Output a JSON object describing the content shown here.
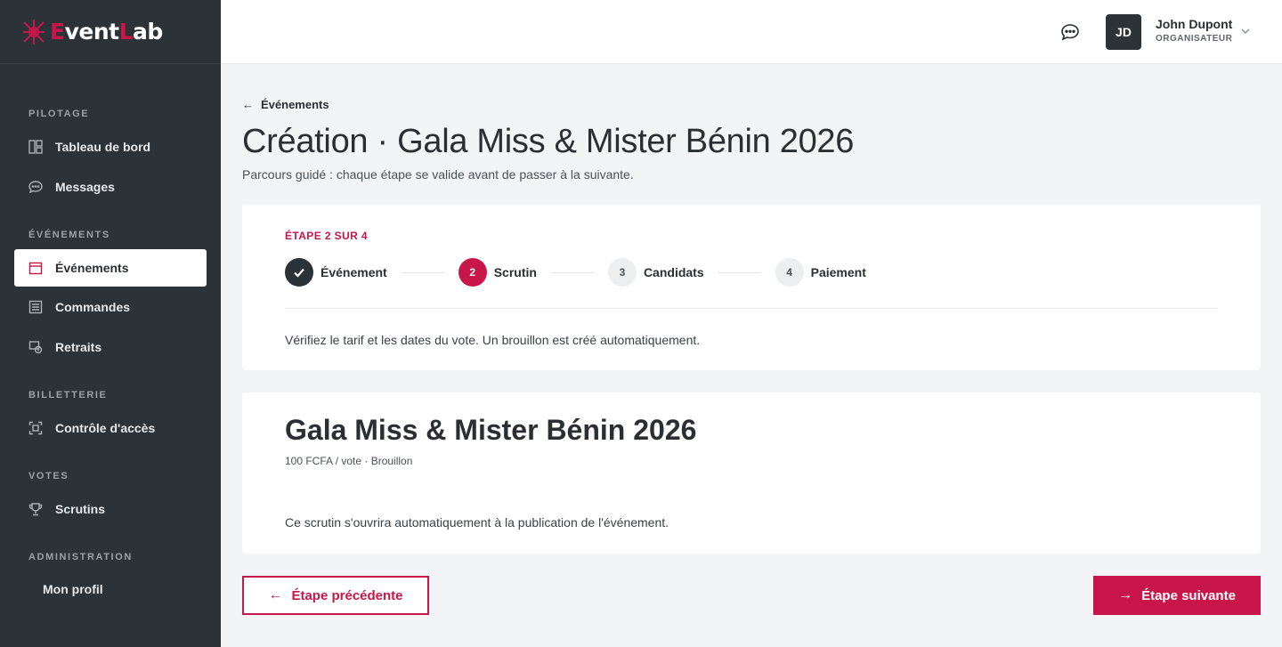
{
  "brand": {
    "part1": "E",
    "part2": "vent",
    "part3": "L",
    "part4": "ab",
    "accent_color": "#c8164a"
  },
  "sidebar": {
    "sections": [
      {
        "label": "PILOTAGE"
      },
      {
        "label": "ÉVÉNEMENTS"
      },
      {
        "label": "BILLETTERIE"
      },
      {
        "label": "VOTES"
      },
      {
        "label": "ADMINISTRATION"
      }
    ],
    "items": [
      {
        "label": "Tableau de bord",
        "icon": "dashboard-icon"
      },
      {
        "label": "Messages",
        "icon": "chat-icon"
      },
      {
        "label": "Événements",
        "icon": "calendar-icon",
        "active": true
      },
      {
        "label": "Commandes",
        "icon": "orders-icon"
      },
      {
        "label": "Retraits",
        "icon": "withdrawal-icon"
      },
      {
        "label": "Contrôle d'accès",
        "icon": "scan-icon"
      },
      {
        "label": "Scrutins",
        "icon": "trophy-icon"
      },
      {
        "label": "Mon profil"
      }
    ]
  },
  "topbar": {
    "avatar_initials": "JD",
    "user_name": "John Dupont",
    "user_role": "ORGANISATEUR"
  },
  "main": {
    "back_label": "Événements",
    "title": "Création · Gala Miss & Mister Bénin 2026",
    "subtitle": "Parcours guidé : chaque étape se valide avant de passer à la suivante.",
    "step_label": "ÉTAPE 2 SUR 4",
    "steps": [
      {
        "number": "✓",
        "name": "Événement",
        "state": "done"
      },
      {
        "number": "2",
        "name": "Scrutin",
        "state": "current"
      },
      {
        "number": "3",
        "name": "Candidats",
        "state": "todo"
      },
      {
        "number": "4",
        "name": "Paiement",
        "state": "todo"
      }
    ],
    "step_description": "Vérifiez le tarif et les dates du vote. Un brouillon est créé automatiquement.",
    "detail": {
      "title": "Gala Miss & Mister Bénin 2026",
      "meta": "100 FCFA / vote · Brouillon",
      "note": "Ce scrutin s'ouvrira automatiquement à la publication de l'événement."
    },
    "prev_label": "Étape précédente",
    "next_label": "Étape suivante"
  }
}
